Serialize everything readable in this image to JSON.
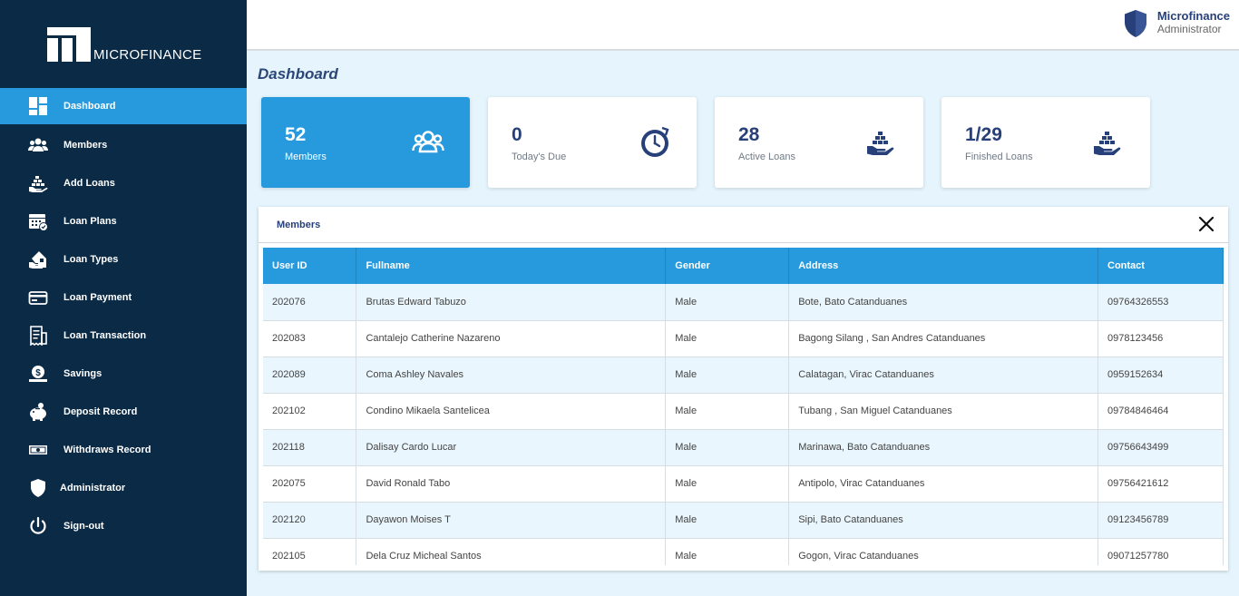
{
  "brand": {
    "logo_text": "MICROFINANCE"
  },
  "header": {
    "user_name": "Microfinance",
    "user_role": "Administrator"
  },
  "page_title": "Dashboard",
  "nav": [
    {
      "label": "Dashboard",
      "icon": "dashboard-icon",
      "active": true
    },
    {
      "label": "Members",
      "icon": "users-icon"
    },
    {
      "label": "Add Loans",
      "icon": "hand-money-icon"
    },
    {
      "label": "Loan Plans",
      "icon": "calendar-icon"
    },
    {
      "label": "Loan Types",
      "icon": "house-hand-icon"
    },
    {
      "label": "Loan Payment",
      "icon": "card-icon"
    },
    {
      "label": "Loan Transaction",
      "icon": "receipt-icon"
    },
    {
      "label": "Savings",
      "icon": "savings-icon"
    },
    {
      "label": "Deposit Record",
      "icon": "piggy-bank-icon"
    },
    {
      "label": "Withdraws Record",
      "icon": "cash-icon"
    },
    {
      "label": "Administrator",
      "icon": "shield-icon"
    },
    {
      "label": "Sign-out",
      "icon": "power-icon"
    }
  ],
  "cards": [
    {
      "value": "52",
      "label": "Members",
      "icon": "users-icon"
    },
    {
      "value": "0",
      "label": "Today's Due",
      "icon": "clock-icon"
    },
    {
      "value": "28",
      "label": "Active Loans",
      "icon": "hand-money-icon"
    },
    {
      "value": "1/29",
      "label": "Finished Loans",
      "icon": "hand-money-icon"
    }
  ],
  "members_panel": {
    "title": "Members",
    "columns": [
      "User ID",
      "Fullname",
      "Gender",
      "Address",
      "Contact"
    ],
    "rows": [
      [
        "202076",
        "Brutas Edward Tabuzo",
        "Male",
        "Bote, Bato Catanduanes",
        "09764326553"
      ],
      [
        "202083",
        "Cantalejo Catherine Nazareno",
        "Male",
        "Bagong Silang , San Andres Catanduanes",
        "0978123456"
      ],
      [
        "202089",
        "Coma Ashley Navales",
        "Male",
        "Calatagan, Virac Catanduanes",
        "0959152634"
      ],
      [
        "202102",
        "Condino Mikaela Santelicea",
        "Male",
        "Tubang , San Miguel Catanduanes",
        "09784846464"
      ],
      [
        "202118",
        "Dalisay Cardo Lucar",
        "Male",
        "Marinawa, Bato Catanduanes",
        "09756643499"
      ],
      [
        "202075",
        "David Ronald Tabo",
        "Male",
        "Antipolo, Virac Catanduanes",
        "09756421612"
      ],
      [
        "202120",
        "Dayawon Moises T",
        "Male",
        "Sipi, Bato Catanduanes",
        "09123456789"
      ],
      [
        "202105",
        "Dela Cruz Micheal Santos",
        "Male",
        "Gogon, Virac Catanduanes",
        "09071257780"
      ]
    ]
  },
  "colors": {
    "sidebar": "#0b2a45",
    "accent": "#2799dd",
    "navy_text": "#27407a",
    "background": "#e6f5fd"
  }
}
